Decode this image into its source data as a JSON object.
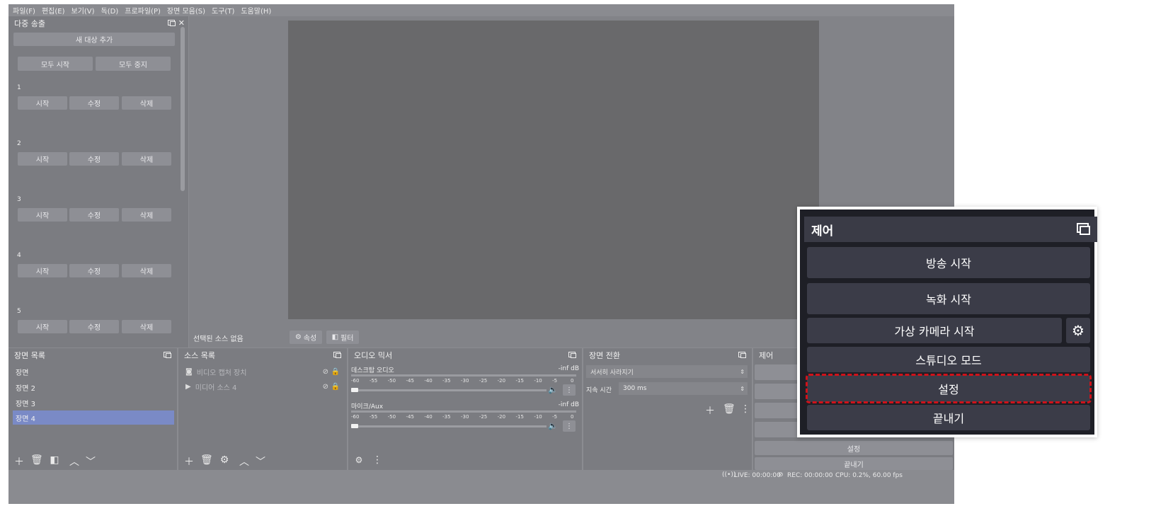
{
  "menu": [
    "파일(F)",
    "편집(E)",
    "보기(V)",
    "독(D)",
    "프로파일(P)",
    "장면 모음(S)",
    "도구(T)",
    "도움말(H)"
  ],
  "multistream": {
    "title": "다중 송출",
    "add_target": "새 대상 추가",
    "start_all": "모두 시작",
    "stop_all": "모두 중지",
    "targets": [
      {
        "num": "1",
        "start": "시작",
        "edit": "수정",
        "delete": "삭제"
      },
      {
        "num": "2",
        "start": "시작",
        "edit": "수정",
        "delete": "삭제"
      },
      {
        "num": "3",
        "start": "시작",
        "edit": "수정",
        "delete": "삭제"
      },
      {
        "num": "4",
        "start": "시작",
        "edit": "수정",
        "delete": "삭제"
      },
      {
        "num": "5",
        "start": "시작",
        "edit": "수정",
        "delete": "삭제"
      }
    ]
  },
  "preview": {
    "no_source": "선택된 소스 없음",
    "properties": "속성",
    "filters": "필터"
  },
  "scenes": {
    "title": "장면 목록",
    "items": [
      "장면",
      "장면 2",
      "장면 3",
      "장면 4"
    ],
    "selected": "장면 4"
  },
  "sources": {
    "title": "소스 목록",
    "items": [
      {
        "icon": "camera-icon",
        "label": "비디오 캡처 장치"
      },
      {
        "icon": "play-icon",
        "label": "미디어 소스 4"
      }
    ]
  },
  "mixer": {
    "title": "오디오 믹서",
    "channels": [
      {
        "name": "데스크탑 오디오",
        "level": "-inf dB"
      },
      {
        "name": "마이크/Aux",
        "level": "-inf dB"
      }
    ],
    "scale": [
      "-60",
      "-55",
      "-50",
      "-45",
      "-40",
      "-35",
      "-30",
      "-25",
      "-20",
      "-15",
      "-10",
      "-5",
      "0"
    ]
  },
  "transitions": {
    "title": "장면 전환",
    "type": "서서히 사라지기",
    "duration_label": "지속 시간",
    "duration_value": "300 ms"
  },
  "controls_small": {
    "title": "제어",
    "settings": "설정",
    "exit": "끝내기"
  },
  "status": {
    "live": "LIVE: 00:00:00",
    "rec": "REC: 00:00:00",
    "cpu": "CPU: 0.2%, 60.00 fps"
  },
  "zoom": {
    "title": "제어",
    "start_stream": "방송 시작",
    "start_record": "녹화 시작",
    "start_virtualcam": "가상 카메라 시작",
    "studio_mode": "스튜디오 모드",
    "settings": "설정",
    "exit": "끝내기",
    "highlight_color": "#d1121a"
  }
}
